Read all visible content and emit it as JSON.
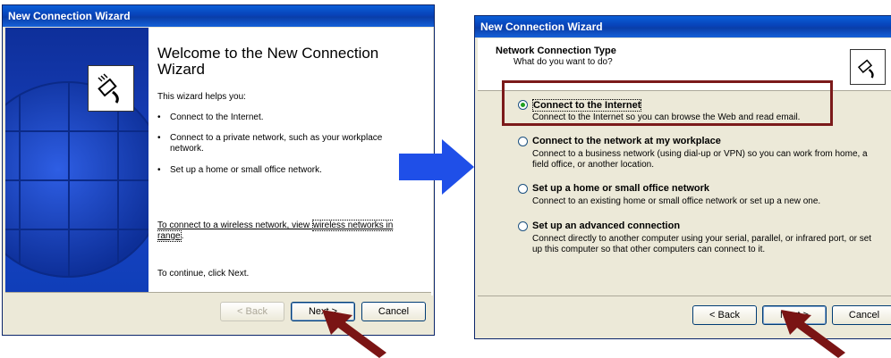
{
  "left_window": {
    "title": "New Connection Wizard",
    "welcome_title": "Welcome to the New Connection Wizard",
    "helps_intro": "This wizard helps you:",
    "bullets": [
      "Connect to the Internet.",
      "Connect to a private network, such as your workplace network.",
      "Set up a home or small office network."
    ],
    "wireless_prefix": "To connect to a wireless network, view ",
    "wireless_link": "wireless networks in range",
    "wireless_suffix": ".",
    "continue_text": "To continue, click Next.",
    "buttons": {
      "back": "< Back",
      "next": "Next >",
      "cancel": "Cancel"
    }
  },
  "right_window": {
    "title": "New Connection Wizard",
    "header_title": "Network Connection Type",
    "header_subtitle": "What do you want to do?",
    "options": [
      {
        "label": "Connect to the Internet",
        "desc": "Connect to the Internet so you can browse the Web and read email.",
        "selected": true
      },
      {
        "label": "Connect to the network at my workplace",
        "desc": "Connect to a business network (using dial-up or VPN) so you can work from home, a field office, or another location.",
        "selected": false
      },
      {
        "label": "Set up a home or small office network",
        "desc": "Connect to an existing home or small office network or set up a new one.",
        "selected": false
      },
      {
        "label": "Set up an advanced connection",
        "desc": "Connect directly to another computer using your serial, parallel, or infrared port, or set up this computer so that other computers can connect to it.",
        "selected": false
      }
    ],
    "buttons": {
      "back": "< Back",
      "next": "Next >",
      "cancel": "Cancel"
    }
  },
  "icons": {
    "wizard_icon": "network-cable-icon",
    "arrow_icon": "blue-arrow-icon",
    "pointer_icon": "red-pointer-arrow-icon"
  },
  "colors": {
    "titlebar": "#0a5fd8",
    "highlight_border": "#7b1a1a",
    "arrow_blue": "#1f4fe8",
    "pointer_red": "#7a1414"
  }
}
